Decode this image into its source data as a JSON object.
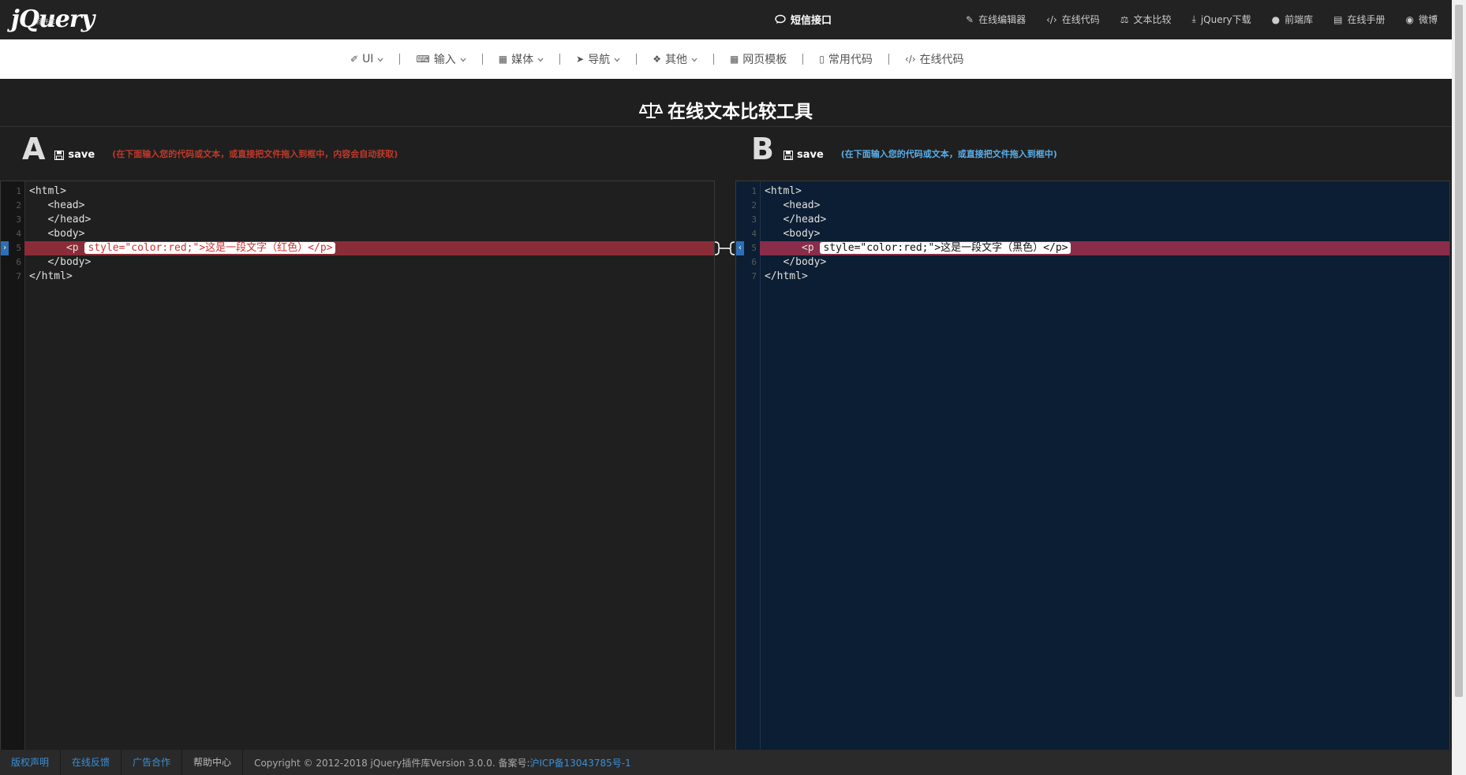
{
  "topbar": {
    "logo": "jQuery",
    "logo_sub": "插件库",
    "sms": "短信接口",
    "nav": [
      {
        "label": "在线编辑器",
        "icon": "edit-icon"
      },
      {
        "label": "在线代码",
        "icon": "code-icon"
      },
      {
        "label": "文本比较",
        "icon": "balance-icon"
      },
      {
        "label": "jQuery下载",
        "icon": "download-icon"
      },
      {
        "label": "前端库",
        "icon": "user-icon"
      },
      {
        "label": "在线手册",
        "icon": "book-icon"
      },
      {
        "label": "微博",
        "icon": "weibo-icon"
      }
    ]
  },
  "subnav": [
    {
      "label": "UI",
      "icon": "brush-icon",
      "dropdown": true
    },
    {
      "label": "输入",
      "icon": "keyboard-icon",
      "dropdown": true
    },
    {
      "label": "媒体",
      "icon": "film-icon",
      "dropdown": true
    },
    {
      "label": "导航",
      "icon": "paper-plane-icon",
      "dropdown": true
    },
    {
      "label": "其他",
      "icon": "dropbox-icon",
      "dropdown": true
    },
    {
      "label": "网页模板",
      "icon": "grid-icon",
      "dropdown": false
    },
    {
      "label": "常用代码",
      "icon": "file-icon",
      "dropdown": false
    },
    {
      "label": "在线代码",
      "icon": "code-icon",
      "dropdown": false
    }
  ],
  "title": "在线文本比较工具",
  "panelA": {
    "letter": "A",
    "save": "save",
    "hint": "(在下面输入您的代码或文本，或直接把文件拖入到框中，内容会自动获取)",
    "hint_color": "#c0392b"
  },
  "panelB": {
    "letter": "B",
    "save": "save",
    "hint": "(在下面输入您的代码或文本，或直接把文件拖入到框中)",
    "hint_color": "#5aaee8"
  },
  "editorA": {
    "lines": [
      {
        "n": "1",
        "code": "<html>"
      },
      {
        "n": "2",
        "code": "   <head>"
      },
      {
        "n": "3",
        "code": "   </head>"
      },
      {
        "n": "4",
        "code": "   <body>"
      },
      {
        "n": "5",
        "code": "      <p ",
        "hl": "style=\"color:red;\">这是一段文字（红色）</p>"
      },
      {
        "n": "6",
        "code": "   </body>"
      },
      {
        "n": "7",
        "code": "</html>"
      }
    ]
  },
  "editorB": {
    "lines": [
      {
        "n": "1",
        "code": "<html>"
      },
      {
        "n": "2",
        "code": "   <head>"
      },
      {
        "n": "3",
        "code": "   </head>"
      },
      {
        "n": "4",
        "code": "   <body>"
      },
      {
        "n": "5",
        "code": "      <p ",
        "hl": "style=\"color:red;\">这是一段文字（黑色）</p>"
      },
      {
        "n": "6",
        "code": "   </body>"
      },
      {
        "n": "7",
        "code": "</html>"
      }
    ]
  },
  "footer": {
    "links": [
      "版权声明",
      "在线反馈",
      "广告合作",
      "帮助中心"
    ],
    "copyright": "Copyright © 2012-2018 jQuery插件库Version 3.0.0. 备案号:",
    "icp": "沪ICP备13043785号-1"
  },
  "colors": {
    "accent": "#3b8fd6",
    "editorB_bg": "#0b1e33",
    "diffA": "#8b2d38",
    "diffB": "#8a2d4a"
  }
}
